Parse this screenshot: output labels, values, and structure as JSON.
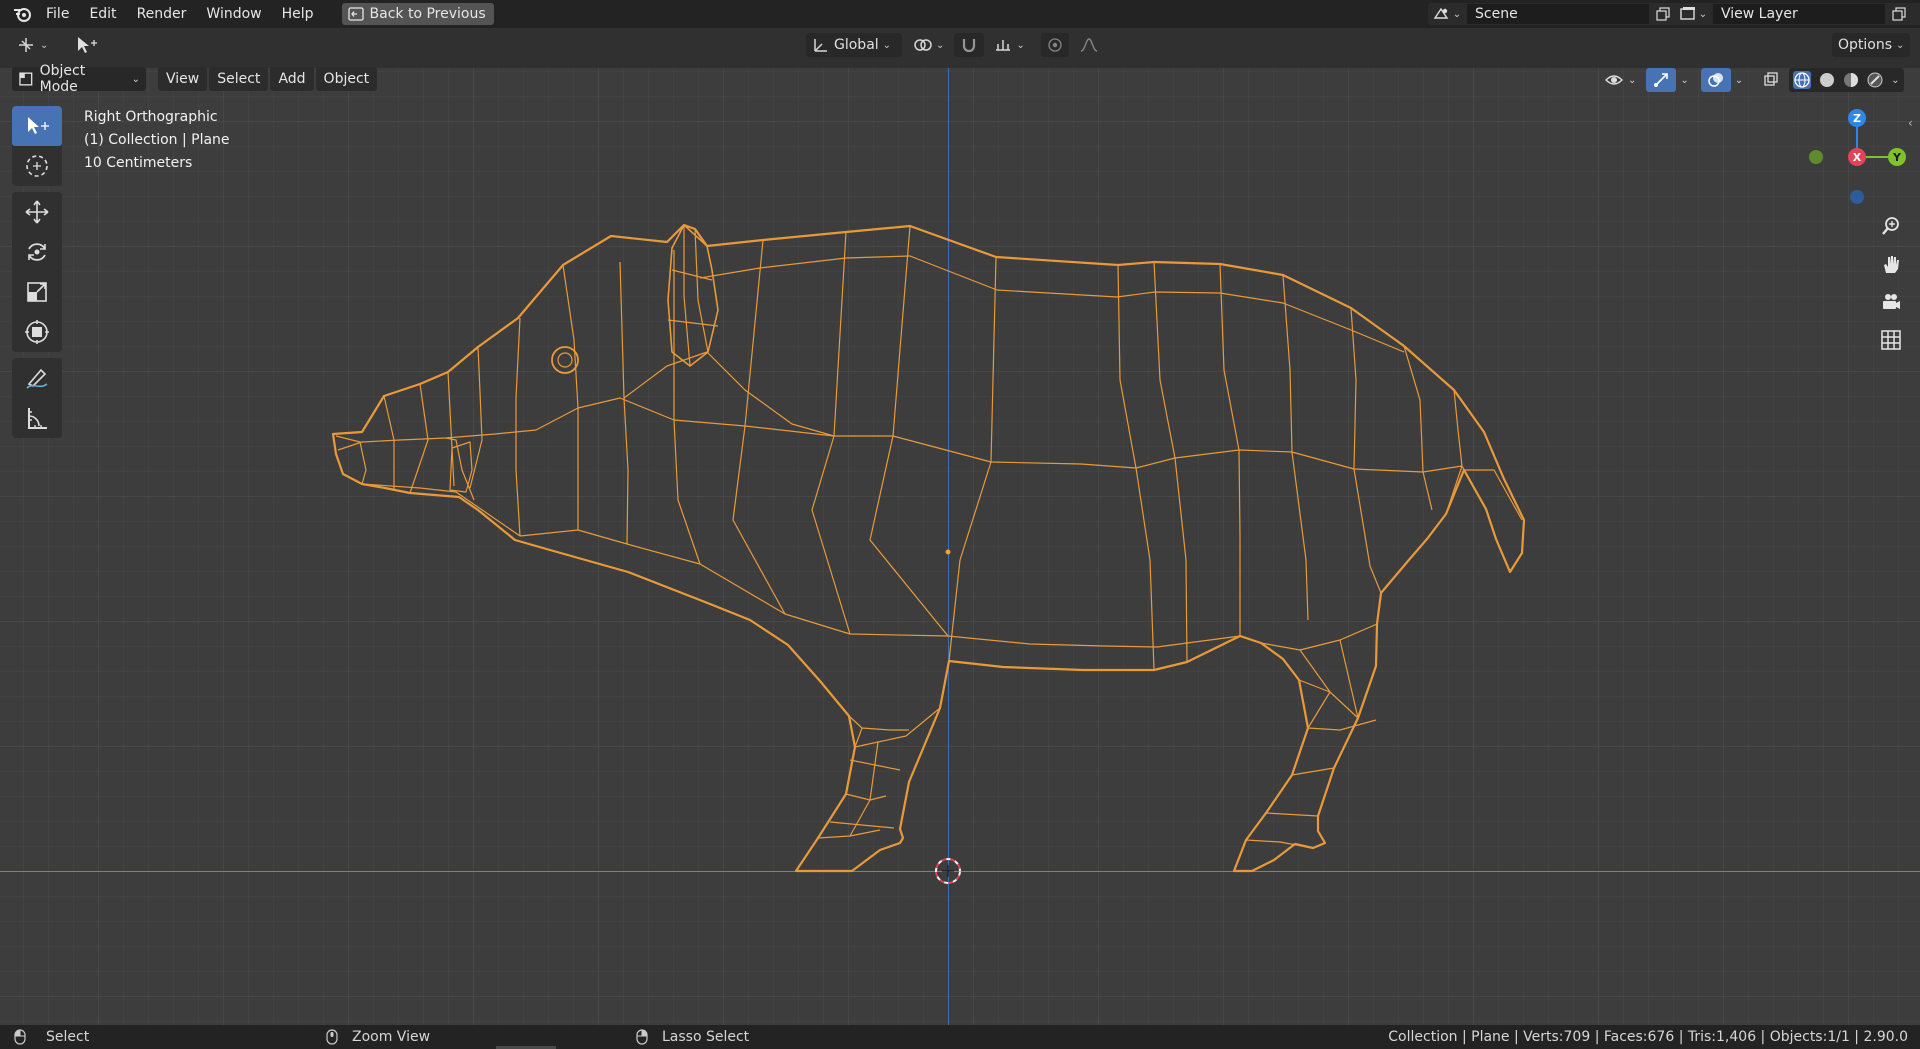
{
  "menu": {
    "items": [
      "File",
      "Edit",
      "Render",
      "Window",
      "Help"
    ],
    "back_button": "Back to Previous"
  },
  "scene": {
    "name": "Scene",
    "view_layer": "View Layer"
  },
  "header": {
    "transform_orientation": "Global",
    "options_label": "Options"
  },
  "viewport_header": {
    "mode": "Object Mode",
    "menus": [
      "View",
      "Select",
      "Add",
      "Object"
    ]
  },
  "overlay": {
    "view_name": "Right Orthographic",
    "collection_info": "(1) Collection | Plane",
    "scale_info": "10 Centimeters"
  },
  "gizmo": {
    "z_label": "Z",
    "x_label": "X",
    "y_label": "Y"
  },
  "colors": {
    "wire": "#e89a3a",
    "accent": "#4772b3",
    "axis_x": "#e0435a",
    "axis_y": "#80c12c",
    "axis_z": "#2f86e5"
  },
  "statusbar": {
    "left_action": "Select",
    "middle_action": "Zoom View",
    "right_action": "Lasso Select",
    "stats": "Collection | Plane | Verts:709 | Faces:676 | Tris:1,406 | Objects:1/1 | 2.90.0"
  }
}
